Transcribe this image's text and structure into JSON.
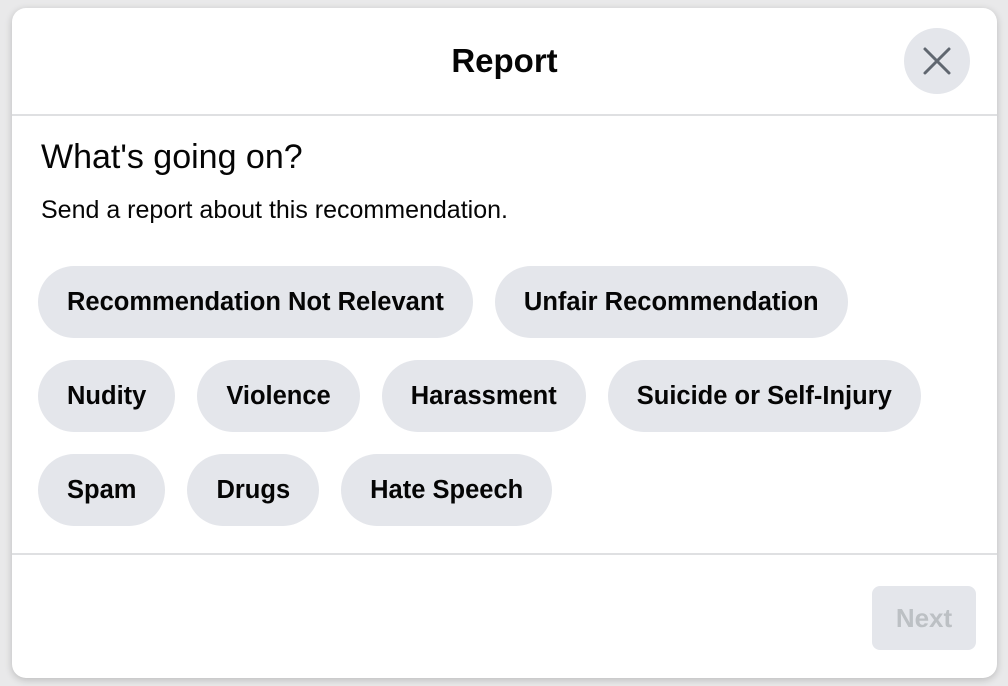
{
  "header": {
    "title": "Report",
    "close_icon": "close-x-icon"
  },
  "body": {
    "heading": "What's going on?",
    "subtitle": "Send a report about this recommendation."
  },
  "options": [
    {
      "label": "Recommendation Not Relevant"
    },
    {
      "label": "Unfair Recommendation"
    },
    {
      "label": "Nudity"
    },
    {
      "label": "Violence"
    },
    {
      "label": "Harassment"
    },
    {
      "label": "Suicide or Self-Injury"
    },
    {
      "label": "Spam"
    },
    {
      "label": "Drugs"
    },
    {
      "label": "Hate Speech"
    }
  ],
  "footer": {
    "next_label": "Next",
    "next_enabled": false
  },
  "colors": {
    "chip_bg": "#e4e6eb",
    "text": "#050505",
    "disabled_text": "#bcc0c4"
  }
}
